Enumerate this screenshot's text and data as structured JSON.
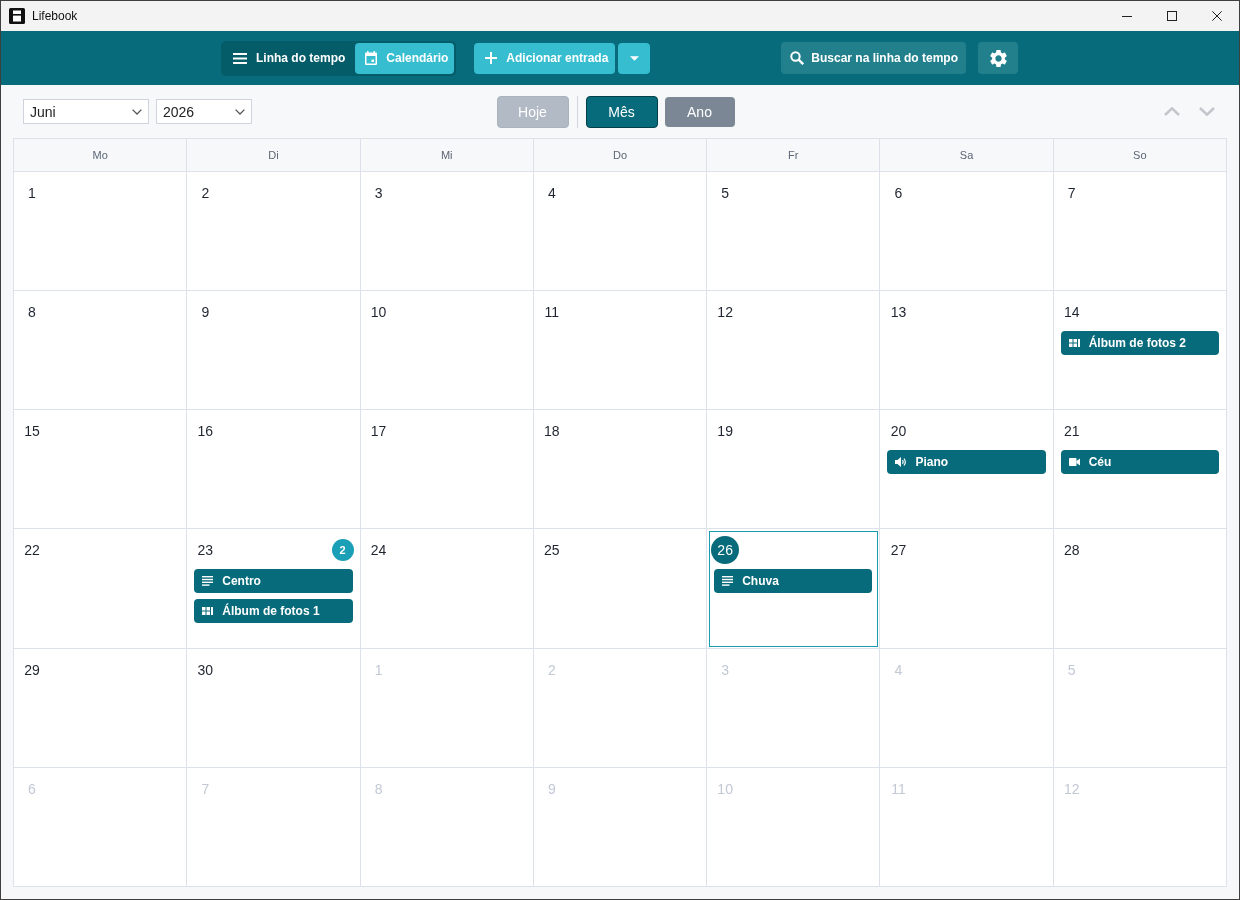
{
  "window": {
    "title": "Lifebook"
  },
  "toolbar": {
    "view_switch": [
      {
        "kind": "timeline",
        "label": "Linha do tempo",
        "selected": false
      },
      {
        "kind": "calendar",
        "label": "Calendário",
        "selected": true
      }
    ],
    "add_entry": {
      "label": "Adicionar entrada"
    },
    "search_button": {
      "label": "Buscar na linha do tempo"
    }
  },
  "controls": {
    "month_select": {
      "value": "Juni"
    },
    "year_select": {
      "value": "2026"
    },
    "today_button": {
      "label": "Hoje",
      "disabled": true
    },
    "view_modes": [
      {
        "label": "Mês",
        "selected": true
      },
      {
        "label": "Ano",
        "selected": false
      }
    ]
  },
  "calendar": {
    "weekdays": [
      "Mo",
      "Di",
      "Mi",
      "Do",
      "Fr",
      "Sa",
      "So"
    ],
    "weeks": [
      {
        "days": [
          {
            "day": "1",
            "in_month": true,
            "today": false
          },
          {
            "day": "2",
            "in_month": true,
            "today": false
          },
          {
            "day": "3",
            "in_month": true,
            "today": false
          },
          {
            "day": "4",
            "in_month": true,
            "today": false
          },
          {
            "day": "5",
            "in_month": true,
            "today": false
          },
          {
            "day": "6",
            "in_month": true,
            "today": false
          },
          {
            "day": "7",
            "in_month": true,
            "today": false
          }
        ]
      },
      {
        "days": [
          {
            "day": "8",
            "in_month": true,
            "today": false
          },
          {
            "day": "9",
            "in_month": true,
            "today": false
          },
          {
            "day": "10",
            "in_month": true,
            "today": false
          },
          {
            "day": "11",
            "in_month": true,
            "today": false
          },
          {
            "day": "12",
            "in_month": true,
            "today": false
          },
          {
            "day": "13",
            "in_month": true,
            "today": false
          },
          {
            "day": "14",
            "in_month": true,
            "today": false,
            "entries": [
              {
                "kind": "album",
                "title": "Álbum de fotos 2"
              }
            ]
          }
        ]
      },
      {
        "days": [
          {
            "day": "15",
            "in_month": true,
            "today": false
          },
          {
            "day": "16",
            "in_month": true,
            "today": false
          },
          {
            "day": "17",
            "in_month": true,
            "today": false
          },
          {
            "day": "18",
            "in_month": true,
            "today": false
          },
          {
            "day": "19",
            "in_month": true,
            "today": false
          },
          {
            "day": "20",
            "in_month": true,
            "today": false,
            "entries": [
              {
                "kind": "audio",
                "title": "Piano"
              }
            ]
          },
          {
            "day": "21",
            "in_month": true,
            "today": false,
            "entries": [
              {
                "kind": "video",
                "title": "Céu"
              }
            ]
          }
        ]
      },
      {
        "days": [
          {
            "day": "22",
            "in_month": true,
            "today": false
          },
          {
            "day": "23",
            "in_month": true,
            "today": false,
            "entry_count": "2",
            "entries": [
              {
                "kind": "text",
                "title": "Centro"
              },
              {
                "kind": "album",
                "title": "Álbum de fotos 1"
              }
            ]
          },
          {
            "day": "24",
            "in_month": true,
            "today": false
          },
          {
            "day": "25",
            "in_month": true,
            "today": false
          },
          {
            "day": "26",
            "in_month": true,
            "today": true,
            "entries": [
              {
                "kind": "text",
                "title": "Chuva"
              }
            ]
          },
          {
            "day": "27",
            "in_month": true,
            "today": false
          },
          {
            "day": "28",
            "in_month": true,
            "today": false
          }
        ]
      },
      {
        "days": [
          {
            "day": "29",
            "in_month": true,
            "today": false
          },
          {
            "day": "30",
            "in_month": true,
            "today": false
          },
          {
            "day": "1",
            "in_month": false,
            "today": false
          },
          {
            "day": "2",
            "in_month": false,
            "today": false
          },
          {
            "day": "3",
            "in_month": false,
            "today": false
          },
          {
            "day": "4",
            "in_month": false,
            "today": false
          },
          {
            "day": "5",
            "in_month": false,
            "today": false
          }
        ]
      },
      {
        "days": [
          {
            "day": "6",
            "in_month": false,
            "today": false
          },
          {
            "day": "7",
            "in_month": false,
            "today": false
          },
          {
            "day": "8",
            "in_month": false,
            "today": false
          },
          {
            "day": "9",
            "in_month": false,
            "today": false
          },
          {
            "day": "10",
            "in_month": false,
            "today": false
          },
          {
            "day": "11",
            "in_month": false,
            "today": false
          },
          {
            "day": "12",
            "in_month": false,
            "today": false
          }
        ]
      }
    ]
  }
}
